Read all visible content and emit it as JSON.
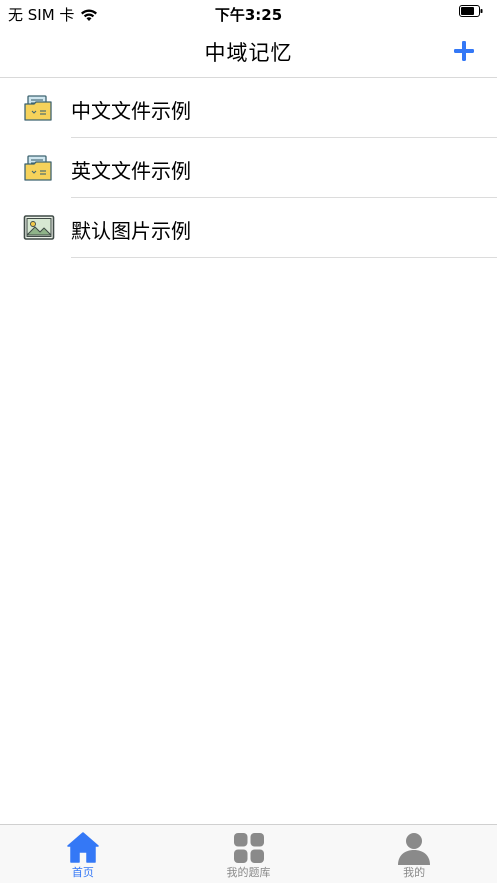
{
  "status_bar": {
    "carrier": "无 SIM 卡",
    "time": "下午3:25",
    "wifi_icon": "wifi-icon",
    "battery_icon": "battery-icon"
  },
  "nav": {
    "title": "中域记忆",
    "add_icon": "plus-icon"
  },
  "list": {
    "items": [
      {
        "label": "中文文件示例",
        "icon": "folder-document-icon"
      },
      {
        "label": "英文文件示例",
        "icon": "folder-document-icon"
      },
      {
        "label": "默认图片示例",
        "icon": "image-icon"
      }
    ]
  },
  "tabs": [
    {
      "label": "首页",
      "icon": "home-icon",
      "active": true
    },
    {
      "label": "我的题库",
      "icon": "grid-icon",
      "active": false
    },
    {
      "label": "我的",
      "icon": "person-icon",
      "active": false
    }
  ],
  "colors": {
    "accent": "#3478f6",
    "inactive": "#8a8a8a",
    "divider": "#dcdcdc"
  }
}
